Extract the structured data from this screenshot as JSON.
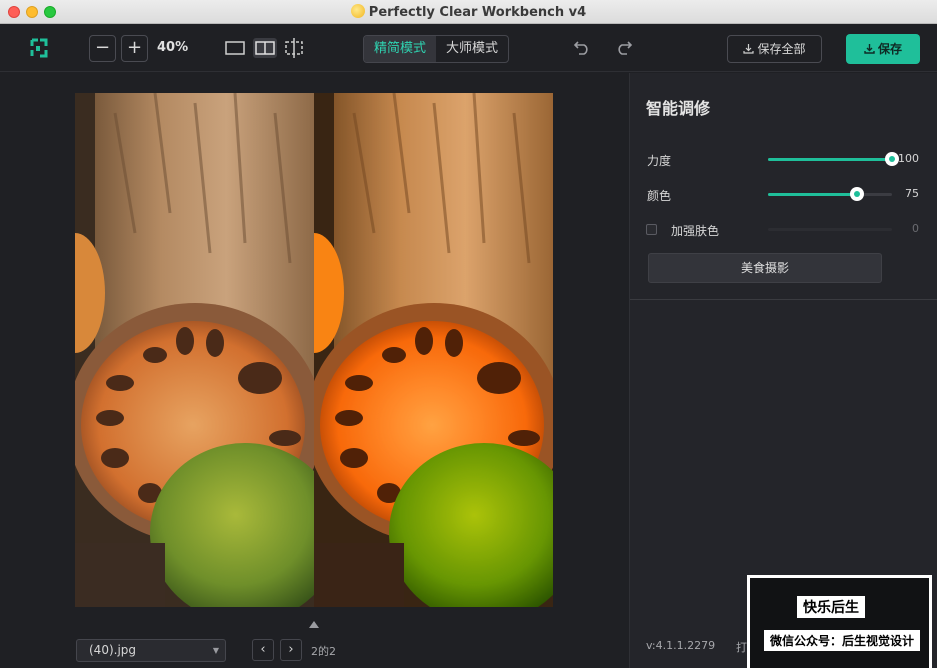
{
  "window": {
    "title": "Perfectly Clear Workbench v4"
  },
  "toolbar": {
    "zoom_out": "−",
    "zoom_in": "+",
    "zoom_level": "40%",
    "modes": [
      {
        "label": "精简模式",
        "active": true
      },
      {
        "label": "大师模式",
        "active": false
      }
    ],
    "save_all_label": "保存全部",
    "save_label": "保存",
    "accent_color": "#1fbf9a",
    "icons": [
      "logo-icon",
      "single-view-icon",
      "split-view-icon",
      "crop-view-icon",
      "undo-icon",
      "redo-icon",
      "download-icon"
    ]
  },
  "stage": {
    "file_name": "(40).jpg",
    "prev": "‹",
    "next": "›",
    "pager": "2的2"
  },
  "panel": {
    "title": "智能调修",
    "sliders": [
      {
        "label": "力度",
        "value": "100",
        "fraction": 1.0,
        "enabled": true
      },
      {
        "label": "颜色",
        "value": "75",
        "fraction": 0.72,
        "enabled": true
      },
      {
        "label": "加强肤色",
        "value": "0",
        "fraction": 0.0,
        "enabled": false
      }
    ],
    "preset_button": "美食摄影",
    "version": "v:4.1.1.2279",
    "open_label": "打开应"
  },
  "watermark": {
    "line1": "快乐后生",
    "line2": "微信公众号：后生视觉设计"
  }
}
